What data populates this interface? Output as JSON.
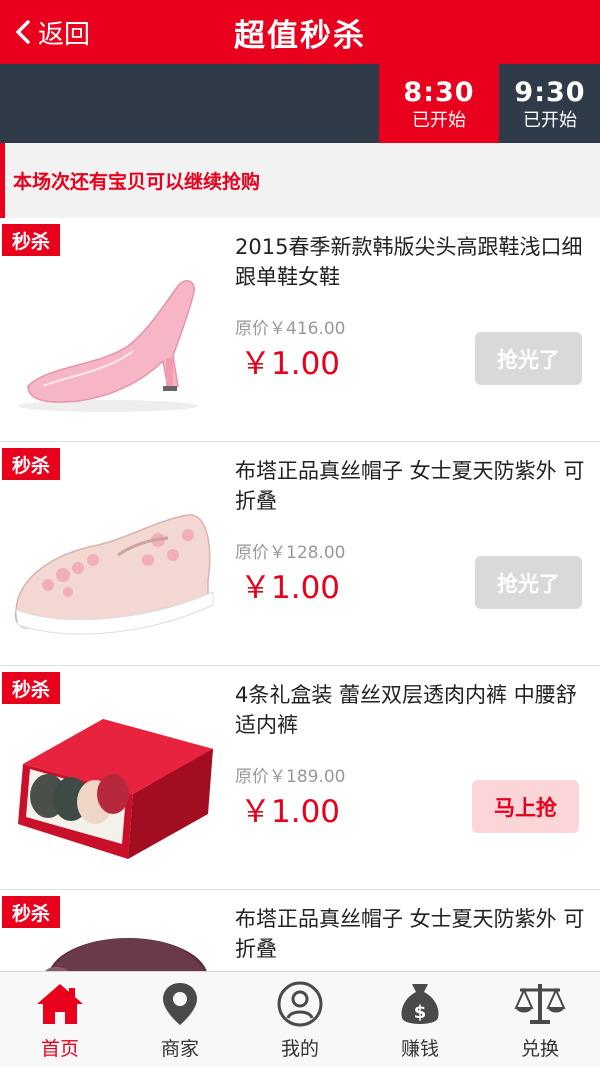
{
  "header": {
    "back_label": "返回",
    "title": "超值秒杀"
  },
  "time_slots": [
    {
      "time": "8:30",
      "status": "已开始",
      "active": true
    },
    {
      "time": "9:30",
      "status": "已开始",
      "active": false
    }
  ],
  "notice": "本场次还有宝贝可以继续抢购",
  "products": [
    {
      "badge": "秒杀",
      "name": "2015春季新款韩版尖头高跟鞋浅口细跟单鞋女鞋",
      "original_price": "原价￥416.00",
      "price": "￥1.00",
      "button": "抢光了",
      "sold_out": true
    },
    {
      "badge": "秒杀",
      "name": "布塔正品真丝帽子 女士夏天防紫外 可折叠",
      "original_price": "原价￥128.00",
      "price": "￥1.00",
      "button": "抢光了",
      "sold_out": true
    },
    {
      "badge": "秒杀",
      "name": "4条礼盒装 蕾丝双层透肉内裤 中腰舒适内裤",
      "original_price": "原价￥189.00",
      "price": "￥1.00",
      "button": "马上抢",
      "sold_out": false
    },
    {
      "badge": "秒杀",
      "name": "布塔正品真丝帽子 女士夏天防紫外 可折叠"
    }
  ],
  "tabs": [
    {
      "label": "首页",
      "icon": "home-icon",
      "active": true
    },
    {
      "label": "商家",
      "icon": "location-pin-icon",
      "active": false
    },
    {
      "label": "我的",
      "icon": "user-icon",
      "active": false
    },
    {
      "label": "赚钱",
      "icon": "money-bag-icon",
      "active": false
    },
    {
      "label": "兑换",
      "icon": "scale-icon",
      "active": false
    }
  ],
  "colors": {
    "brand_red": "#e8001c",
    "dark_bar": "#2f3b48",
    "sold_out_gray": "#d9d9d9",
    "grab_pink": "#fbd5d8"
  }
}
